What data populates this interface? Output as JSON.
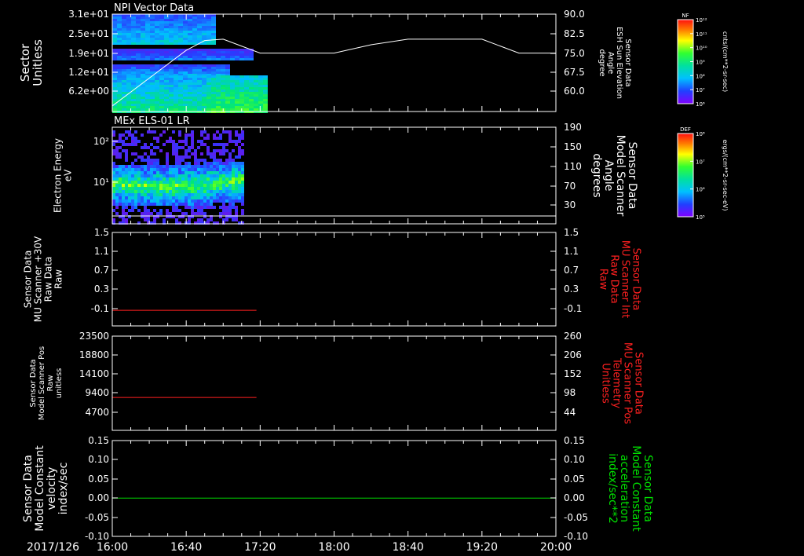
{
  "date_label": "2017/126",
  "x_ticks": [
    "16:00",
    "16:40",
    "17:20",
    "18:00",
    "18:40",
    "19:20",
    "20:00"
  ],
  "x_range_hours": [
    16.0,
    20.0
  ],
  "colors": {
    "axis": "#ffffff",
    "red": "#ff2020",
    "green": "#00e000",
    "line": "#ffffff"
  },
  "panels": [
    {
      "title": "NPI Vector Data",
      "left_label": [
        "Sector",
        "Unitless"
      ],
      "left_ticks": [
        "3.1e+01",
        "2.5e+01",
        "1.9e+01",
        "1.2e+01",
        "6.2e+00"
      ],
      "right_label": [
        "Sensor Data",
        "ESH Sun Elevation",
        "Angle",
        "degree"
      ],
      "right_ticks": [
        "90.0",
        "82.5",
        "75.0",
        "67.5",
        "60.0"
      ],
      "colorbar": {
        "title": "NF",
        "ticks": [
          "10¹²",
          "10¹¹",
          "10¹⁰",
          "10⁹",
          "10⁸",
          "10⁷",
          "10⁶"
        ],
        "unit": "cnts/(cm**2-sr-sec)"
      }
    },
    {
      "title": "MEx ELS-01 LR",
      "left_label": [
        "Electron Energy",
        "eV"
      ],
      "left_ticks": [
        "10²",
        "10¹"
      ],
      "right_label": [
        "Sensor Data",
        "Model Scanner",
        "Angle",
        "degrees"
      ],
      "right_ticks": [
        "190",
        "150",
        "110",
        "70",
        "30"
      ],
      "colorbar": {
        "title": "DEF",
        "ticks": [
          "10⁸",
          "10⁷",
          "10⁶",
          "10⁵"
        ],
        "unit": "ergs/(cm**2-sr-sec-eV)"
      }
    },
    {
      "left_label": [
        "Sensor Data",
        "MU Scanner +30V",
        "Raw Data",
        "Raw"
      ],
      "left_ticks": [
        "1.5",
        "1.1",
        "0.7",
        "0.3",
        "-0.1"
      ],
      "right_label": [
        "Sensor Data",
        "MU Scanner Int",
        "Raw Data",
        "Raw"
      ],
      "right_ticks": [
        "1.5",
        "1.1",
        "0.7",
        "0.3",
        "-0.1"
      ]
    },
    {
      "left_label": [
        "Sensor Data",
        "Model Scanner Pos",
        "Raw",
        "unitless"
      ],
      "left_ticks": [
        "23500",
        "18800",
        "14100",
        "9400",
        "4700"
      ],
      "right_label": [
        "Sensor Data",
        "MU Scanner Pos",
        "Telemetry",
        "Unitless"
      ],
      "right_ticks": [
        "260",
        "206",
        "152",
        "98",
        "44"
      ]
    },
    {
      "left_label": [
        "Sensor Data",
        "Model Constant",
        "velocity",
        "index/sec"
      ],
      "left_ticks": [
        "0.15",
        "0.10",
        "0.05",
        "0.00",
        "-0.05",
        "-0.10"
      ],
      "right_label": [
        "Sensor Data",
        "Model Constant",
        "acceleration",
        "index/sec**2"
      ],
      "right_ticks": [
        "0.15",
        "0.10",
        "0.05",
        "0.00",
        "-0.05",
        "-0.10"
      ]
    }
  ],
  "chart_data": [
    {
      "type": "heatmap",
      "title": "NPI Vector Data",
      "ylabel": "Sector Unitless",
      "x_range": [
        "16:00",
        "20:00"
      ],
      "y_range": [
        0,
        31
      ],
      "data_end_time": "17:14",
      "overlay_line": {
        "name": "ESH Sun Elevation Angle",
        "axis": "right",
        "ylim": [
          55,
          90
        ],
        "x": [
          "16:00",
          "16:20",
          "16:40",
          "16:50",
          "17:00",
          "17:10",
          "17:20",
          "18:00",
          "18:20",
          "18:40",
          "19:20",
          "19:30",
          "19:40",
          "20:00"
        ],
        "values": [
          57,
          67,
          77,
          80.5,
          81,
          78.5,
          76,
          76,
          79,
          81,
          81,
          78.5,
          76,
          76
        ]
      }
    },
    {
      "type": "heatmap",
      "title": "MEx ELS-01 LR",
      "ylabel": "Electron Energy eV",
      "yscale": "log",
      "x_range": [
        "16:00",
        "20:00"
      ],
      "y_range": [
        2,
        180
      ],
      "data_end_time": "17:10",
      "overlay_line": {
        "name": "Model Scanner Angle",
        "axis": "right",
        "ylim": [
          10,
          190
        ],
        "value": 10
      }
    },
    {
      "type": "line",
      "series": [
        {
          "name": "MU Scanner +30V Raw Data",
          "x": [
            "16:00",
            "17:18"
          ],
          "values": [
            0.0,
            0.0
          ],
          "color": "#ff2020"
        }
      ],
      "ylim": [
        -0.3,
        1.5
      ]
    },
    {
      "type": "line",
      "series": [
        {
          "name": "Model Scanner Pos",
          "x": [
            "16:00",
            "17:18"
          ],
          "values": [
            8200,
            8200
          ],
          "color": "#ff2020"
        }
      ],
      "ylim": [
        0,
        23500
      ]
    },
    {
      "type": "line",
      "series": [
        {
          "name": "Model Constant velocity",
          "x": [
            "16:00",
            "20:00"
          ],
          "values": [
            0.0,
            0.0
          ],
          "color": "#00e000"
        }
      ],
      "ylim": [
        -0.1,
        0.15
      ]
    }
  ]
}
